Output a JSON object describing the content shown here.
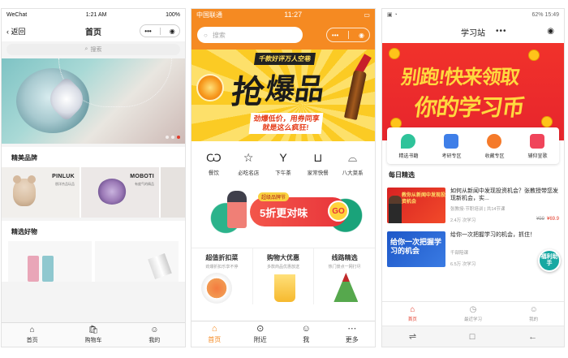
{
  "phone1": {
    "status": {
      "carrier": "WeChat",
      "time": "1:21 AM",
      "battery": "100%"
    },
    "nav": {
      "back_label": "返回",
      "title": "首页"
    },
    "search_placeholder": "搜索",
    "sections": {
      "brands": "精美品牌",
      "goods": "精选好物"
    },
    "brands": [
      {
        "name": "PINLUK",
        "sub": "朋洋杰品玩品"
      },
      {
        "name": "MOBOTI",
        "sub": "有度气的精品"
      }
    ],
    "tabs": [
      {
        "label": "首页",
        "icon": "home-icon"
      },
      {
        "label": "购物车",
        "icon": "cart-icon"
      },
      {
        "label": "我的",
        "icon": "user-icon"
      }
    ]
  },
  "phone2": {
    "status": {
      "carrier": "中国联通",
      "time": "11:27"
    },
    "search_placeholder": "搜索",
    "banner": {
      "tag": "千款好评万人空巷",
      "headline_1": "抢",
      "headline_2": "爆品",
      "sub_1": "劲爆低价，用券同享",
      "sub_2": "就是这么疯狂!"
    },
    "categories": [
      {
        "label": "餐饮",
        "icon": "food-icon"
      },
      {
        "label": "必吃名店",
        "icon": "star-icon"
      },
      {
        "label": "下午茶",
        "icon": "cocktail-icon"
      },
      {
        "label": "家常快餐",
        "icon": "pot-icon"
      },
      {
        "label": "八大菜系",
        "icon": "dish-icon"
      }
    ],
    "promo": {
      "small": "超级品牌节",
      "main": "5折更对味",
      "go": "GO"
    },
    "deals": [
      {
        "title": "超值折扣菜",
        "sub": "劲爆折扣乐享不停"
      },
      {
        "title": "购物大优惠",
        "sub": "多款商品优惠放送"
      },
      {
        "title": "线路精选",
        "sub": "热门景点一网打尽"
      }
    ],
    "tabs": [
      {
        "label": "首页",
        "icon": "home-icon",
        "active": true
      },
      {
        "label": "附近",
        "icon": "location-icon"
      },
      {
        "label": "我",
        "icon": "user-icon"
      },
      {
        "label": "更多",
        "icon": "more-icon"
      }
    ]
  },
  "phone3": {
    "status": {
      "battery": "62%",
      "time": "15:49"
    },
    "nav": {
      "title": "学习站"
    },
    "banner": {
      "line_1": "别跑!快来领取",
      "line_2": "你的学习币"
    },
    "entries": [
      {
        "label": "精选书籍",
        "color": "#2fc39a"
      },
      {
        "label": "考研专区",
        "color": "#3f7fe8"
      },
      {
        "label": "收藏专区",
        "color": "#f57a2a"
      },
      {
        "label": "辅仰宣歌",
        "color": "#f0445a"
      }
    ],
    "daily_title": "每日精选",
    "items": [
      {
        "title": "如何从新闻中发现投资机会？张教授带您发现新机会，实...",
        "sub": "张教授-节职培训 | 共14节课",
        "count": "2.4万",
        "unit": "次学习",
        "old_price": "¥99",
        "price": "¥69.9",
        "thumb_text": "教你从新闻中发现投资机会"
      },
      {
        "title": "给你一次把握学习的机会，抓住！",
        "sub": "千部陪课",
        "count": "6.5万",
        "unit": "次学习",
        "price": "¥1",
        "thumb_text": "给你一次把握学习的机会"
      }
    ],
    "float_badge": "福利助手",
    "tabs": [
      {
        "label": "首页",
        "icon": "home-icon",
        "active": true
      },
      {
        "label": "最近学习",
        "icon": "clock-icon"
      },
      {
        "label": "我的",
        "icon": "user-icon"
      }
    ]
  }
}
